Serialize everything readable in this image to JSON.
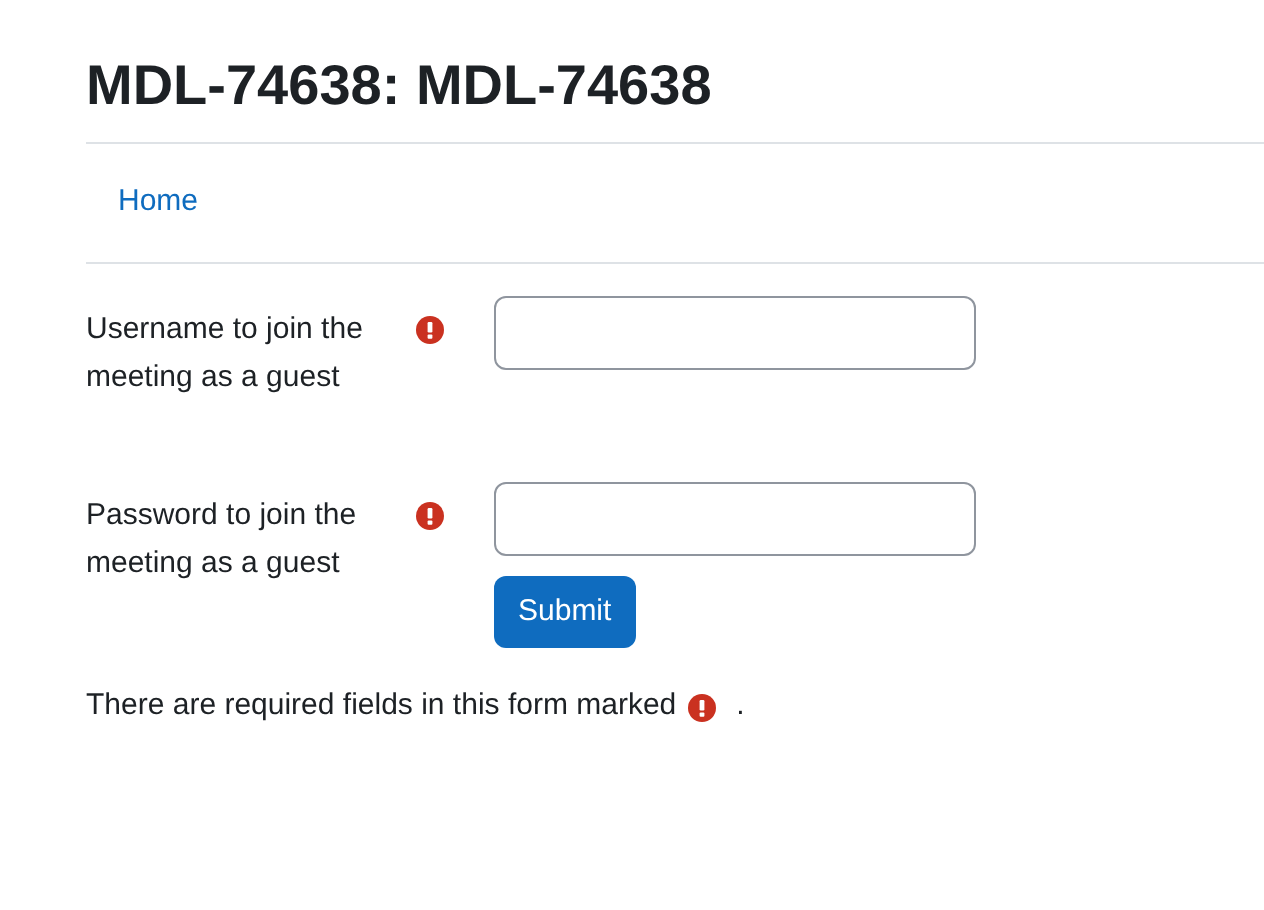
{
  "page_title": "MDL-74638: MDL-74638",
  "nav": {
    "link": "Home"
  },
  "fields": [
    {
      "label": "Username to join the meeting as a guest",
      "required": true
    },
    {
      "label": "Password to join the meeting as a guest",
      "required": true
    }
  ],
  "submit_button": "Submit",
  "required_note": {
    "text": "There are required fields in this form marked",
    "end": "."
  }
}
